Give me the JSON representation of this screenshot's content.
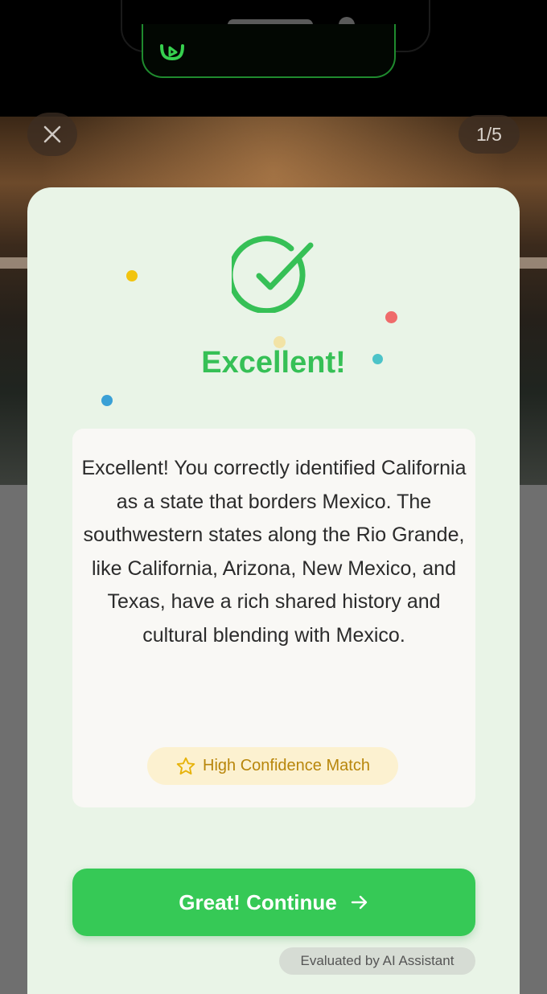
{
  "header": {
    "close_icon": "close-icon",
    "progress_counter": "1/5"
  },
  "result": {
    "status_icon": "check-circle-icon",
    "headline": "Excellent!",
    "feedback": "Excellent! You correctly identified California as a state that borders Mexico. The southwestern states along the Rio Grande, like California, Arizona, New Mexico, and Texas, have a rich shared history and cultural blending with Mexico.",
    "confidence_badge": {
      "icon": "star-icon",
      "label": "High Confidence Match"
    },
    "continue_button": {
      "label": "Great! Continue",
      "icon": "arrow-right-icon"
    },
    "evaluator_note": "Evaluated by AI Assistant"
  },
  "colors": {
    "accent_green": "#36c956",
    "card_background": "#e9f4e7",
    "badge_text": "#b8860b",
    "confetti": [
      "#f2c40f",
      "#f2e3a6",
      "#ef6b6b",
      "#4cc3c8",
      "#3aa0d6"
    ]
  }
}
